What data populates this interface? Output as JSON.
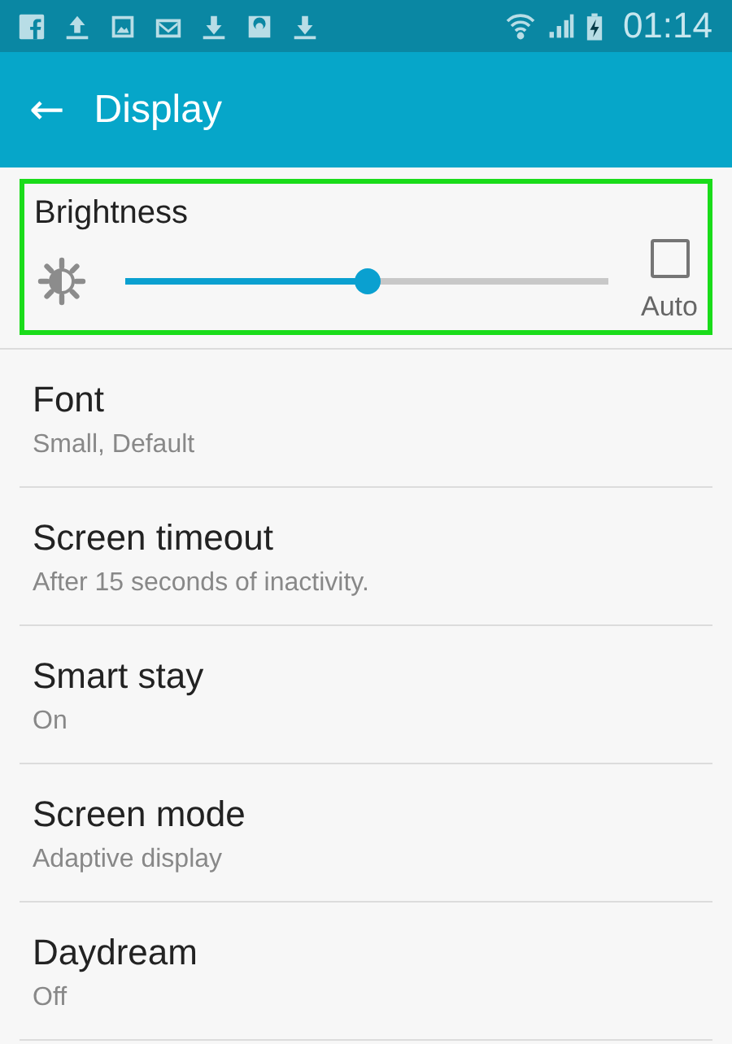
{
  "status_bar": {
    "notification_icons": [
      {
        "kind": "facebook"
      },
      {
        "kind": "upload"
      },
      {
        "kind": "image"
      },
      {
        "kind": "mail"
      },
      {
        "kind": "download"
      },
      {
        "kind": "instagram"
      },
      {
        "kind": "download"
      }
    ],
    "time": "01:14"
  },
  "app_bar": {
    "back": "←",
    "title": "Display"
  },
  "brightness": {
    "title": "Brightness",
    "highlighted": true,
    "level": 0.5,
    "auto": {
      "label": "Auto",
      "checked": false
    }
  },
  "settings": [
    {
      "title": "Font",
      "summary": "Small, Default"
    },
    {
      "title": "Screen timeout",
      "summary": "After 15 seconds of inactivity."
    },
    {
      "title": "Smart stay",
      "summary": "On"
    },
    {
      "title": "Screen mode",
      "summary": "Adaptive display"
    },
    {
      "title": "Daydream",
      "summary": "Off"
    }
  ]
}
